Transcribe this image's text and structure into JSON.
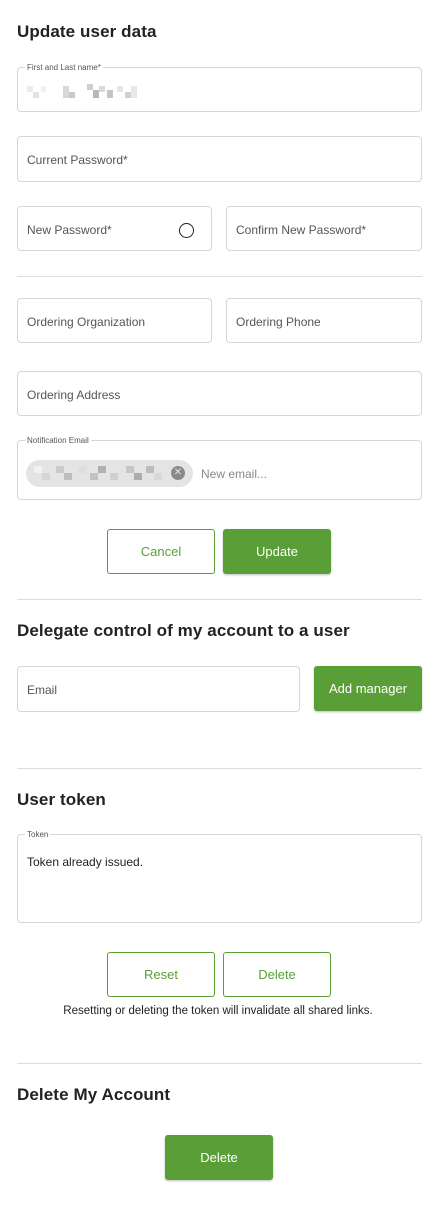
{
  "update": {
    "title": "Update user data",
    "name_label": "First and Last name*",
    "current_password": "Current Password*",
    "new_password": "New Password*",
    "confirm_password": "Confirm New Password*",
    "ordering_org": "Ordering Organization",
    "ordering_phone": "Ordering Phone",
    "ordering_address": "Ordering Address",
    "notification_label": "Notification Email",
    "new_email_placeholder": "New email...",
    "cancel": "Cancel",
    "update": "Update"
  },
  "delegate": {
    "title": "Delegate control of my account to a user",
    "email_placeholder": "Email",
    "add_manager": "Add manager"
  },
  "token": {
    "title": "User token",
    "label": "Token",
    "value": "Token already issued.",
    "reset": "Reset",
    "delete": "Delete",
    "note": "Resetting or deleting the token will invalidate all shared links."
  },
  "delete_account": {
    "title": "Delete My Account",
    "delete": "Delete"
  },
  "colors": {
    "accent": "#5a9e37",
    "border": "#d6d6d6"
  },
  "icons": {
    "password_toggle": "circle-icon",
    "chip_remove": "close-circle-icon"
  }
}
